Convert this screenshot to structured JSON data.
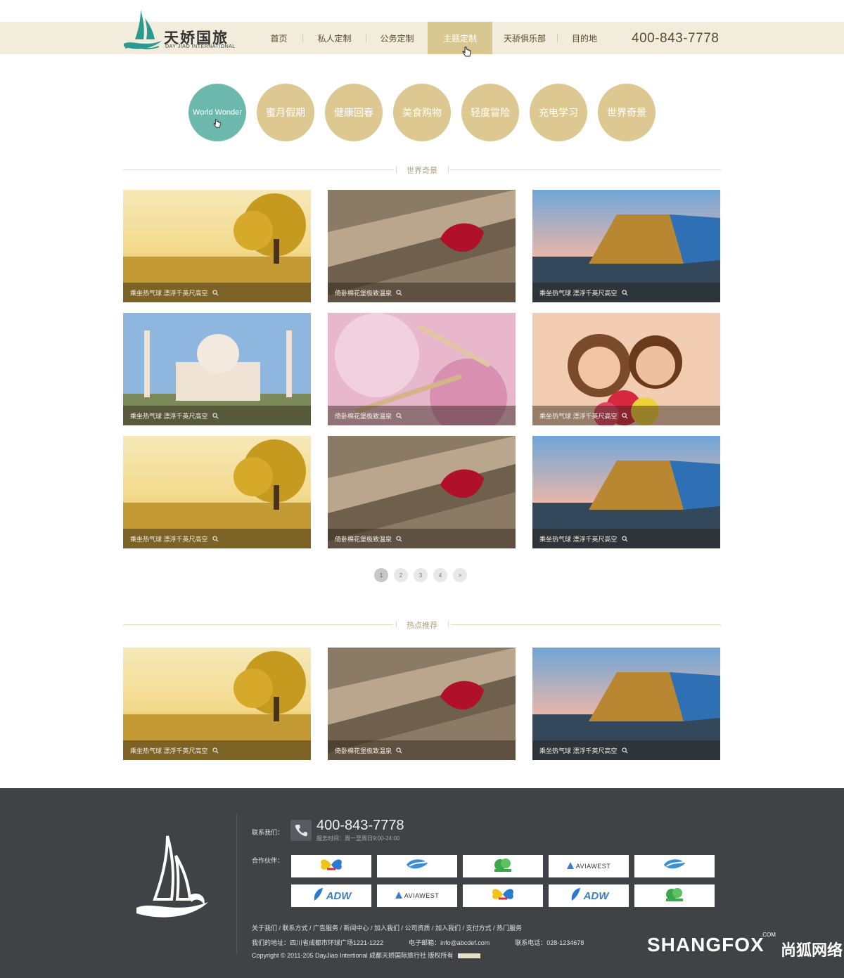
{
  "brand": {
    "name_cn": "天娇国旅",
    "name_en": "DAY JIAO INTERNATIONAL"
  },
  "nav": {
    "items": [
      {
        "label": "首页",
        "w": 67
      },
      {
        "label": "私人定制",
        "w": 89
      },
      {
        "label": "公务定制",
        "w": 87
      },
      {
        "label": "主题定制",
        "w": 92,
        "active": true
      },
      {
        "label": "天骄俱乐部",
        "w": 92
      },
      {
        "label": "目的地",
        "w": 76
      }
    ],
    "phone": "400-843-7778"
  },
  "themes": [
    {
      "label": "World Wonder",
      "active": true
    },
    {
      "label": "蜜月假期"
    },
    {
      "label": "健康回春"
    },
    {
      "label": "美食购物"
    },
    {
      "label": "轻度冒险"
    },
    {
      "label": "充电学习"
    },
    {
      "label": "世界奇景"
    }
  ],
  "sections": {
    "wonders_title": "世界奇景",
    "hot_title": "热点推荐"
  },
  "cards": [
    {
      "caption": "乘坐热气球  漂浮千英尺高空",
      "scene": "tree"
    },
    {
      "caption": "倚卧棉花堡极致温泉",
      "scene": "flower"
    },
    {
      "caption": "乘坐热气球  漂浮千英尺高空",
      "scene": "building"
    },
    {
      "caption": "乘坐热气球  漂浮千英尺高空",
      "scene": "taj"
    },
    {
      "caption": "倚卧棉花堡极致温泉",
      "scene": "brush"
    },
    {
      "caption": "乘坐热气球  漂浮千英尺高空",
      "scene": "kids"
    },
    {
      "caption": "乘坐热气球  漂浮千英尺高空",
      "scene": "tree"
    },
    {
      "caption": "倚卧棉花堡极致温泉",
      "scene": "flower"
    },
    {
      "caption": "乘坐热气球  漂浮千英尺高空",
      "scene": "building"
    }
  ],
  "hot_cards": [
    {
      "caption": "乘坐热气球  漂浮千英尺高空",
      "scene": "tree"
    },
    {
      "caption": "倚卧棉花堡极致温泉",
      "scene": "flower"
    },
    {
      "caption": "乘坐热气球  漂浮千英尺高空",
      "scene": "building"
    }
  ],
  "pagination": {
    "pages": [
      "1",
      "2",
      "3",
      "4",
      ">"
    ],
    "current": "1"
  },
  "footer": {
    "contact_label": "联系我们：",
    "phone": "400-843-7778",
    "hours": "服务时间：周一至周日9:00-24:00",
    "partners_label": "合作伙伴：",
    "partners": [
      {
        "name": "butterfly"
      },
      {
        "name": "wave"
      },
      {
        "name": "leaf"
      },
      {
        "name": "aviawest",
        "text": "AVIAWEST"
      },
      {
        "name": "wave"
      },
      {
        "name": "adw",
        "text": "ADW"
      },
      {
        "name": "aviawest",
        "text": "AVIAWEST"
      },
      {
        "name": "butterfly"
      },
      {
        "name": "adw",
        "text": "ADW"
      },
      {
        "name": "leaf"
      }
    ],
    "links": "关于我们 / 联系方式 / 广告服务 / 新闻中心 / 加入我们 / 公司资质 / 加入我们 / 支付方式 / 热门服务",
    "address": "我们的地址：四川省成都市环球广场1221-1222",
    "email": "电子邮箱：info@abcdef.com",
    "tel": "联系电话：028-1234678",
    "copyright": "Copyright © 2011-205 DayJiao Intertional 成都天娇国际旅行社 版权所有"
  },
  "watermark": {
    "text": "SHANGFOX",
    "com": ".COM",
    "cn": "尚狐网络"
  },
  "colors": {
    "accent": "#d9c792",
    "teal": "#6cb8ad",
    "footer": "#414246"
  }
}
